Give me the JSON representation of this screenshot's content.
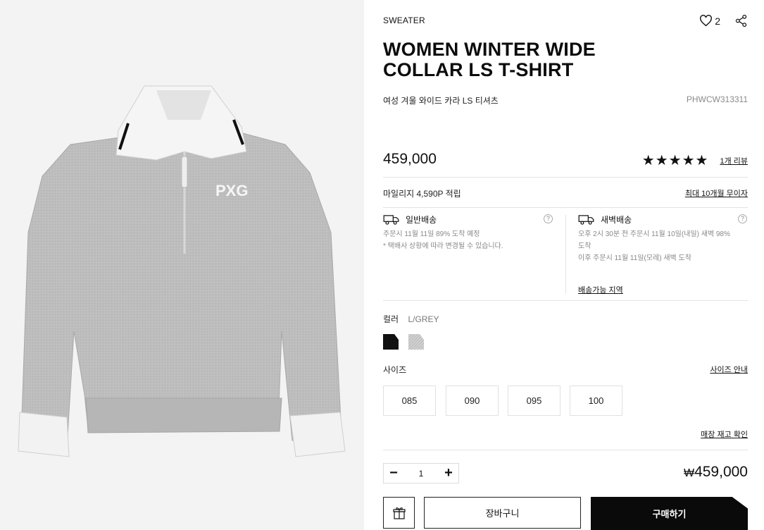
{
  "product": {
    "category": "SWEATER",
    "title": "WOMEN WINTER WIDE COLLAR LS T-SHIRT",
    "subtitle_ko": "여성 겨울 와이드 카라 LS 티셔츠",
    "sku": "PHWCW313311",
    "price": "459,000",
    "like_count": "2",
    "rating_stars": "★★★★★",
    "rating_value": 5,
    "review_link": "1개 리뷰",
    "image_logo": "PXG"
  },
  "benefits": {
    "mileage": "마일리지 4,590P 적립",
    "installment": "최대 10개월 무이자"
  },
  "shipping": {
    "standard": {
      "title": "일반배송",
      "line1_a": "주문시 11월 11일 89% 도착 예정",
      "note": "* 택배사 상황에 따라 변경될 수 있습니다."
    },
    "dawn": {
      "title": "새벽배송",
      "line1": "오후 2시 30분 전 주문시 11월 10일(내일) 새벽 98%",
      "line2": "도착",
      "line3": "이후 주문시 11월 11일(모레) 새벽 도착",
      "area_link": "배송가능 지역"
    },
    "help": "?"
  },
  "options": {
    "color_label": "컬러",
    "color_value": "L/GREY",
    "swatches": [
      {
        "name": "black",
        "color": "#111111"
      },
      {
        "name": "light-grey",
        "color": "#c9c9c9"
      }
    ],
    "size_label": "사이즈",
    "size_guide": "사이즈 안내",
    "sizes": [
      "085",
      "090",
      "095",
      "100"
    ],
    "stock_link": "매장 재고 확인"
  },
  "order": {
    "quantity": "1",
    "minus": "−",
    "plus": "+",
    "total_currency": "₩",
    "total": "459,000",
    "cart_label": "장바구니",
    "buy_label": "구매하기"
  },
  "colors": {
    "image_bg": "#f3f3f3",
    "sweater": "#b9b9b9",
    "collar": "#f4f4f4",
    "accent": "#0a0a0a"
  }
}
